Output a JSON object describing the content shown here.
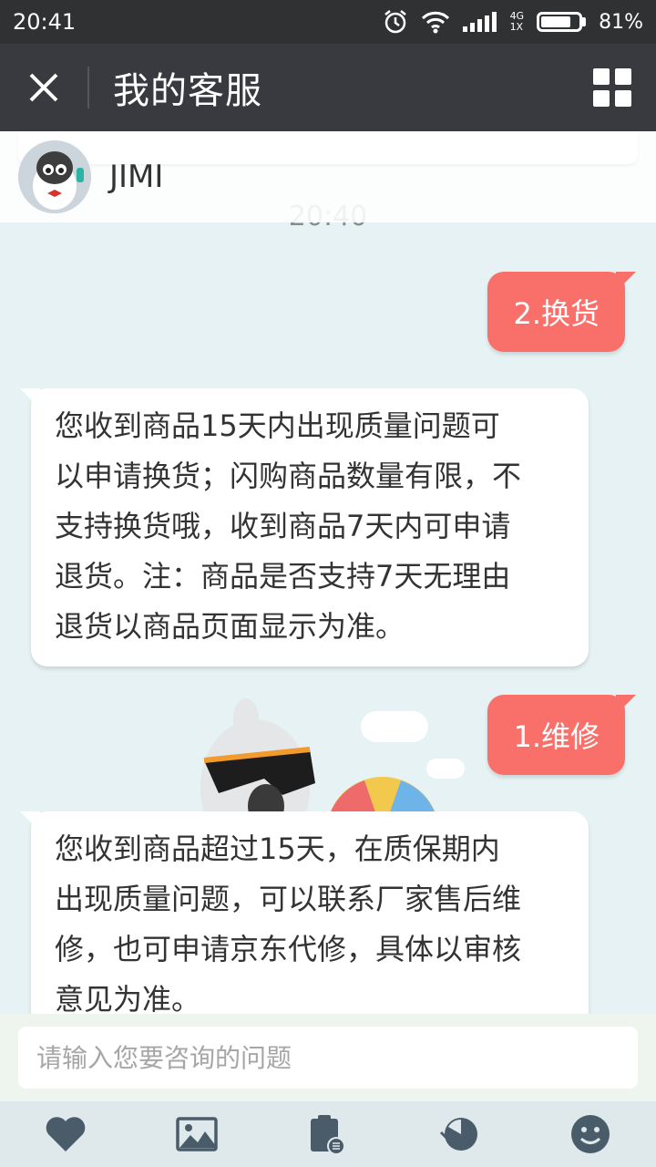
{
  "status_bar": {
    "time": "20:41",
    "network": "4G",
    "network_sub": "1X",
    "battery_percent": "81%",
    "battery_level": 0.81
  },
  "header": {
    "title": "我的客服"
  },
  "agent": {
    "name": "JIMI"
  },
  "chat": {
    "timestamp": "20:40",
    "messages": [
      {
        "from": "user",
        "text": "2.换货"
      },
      {
        "from": "agent",
        "lines": [
          "您收到商品15天内出现质量问题可",
          "以申请换货；闪购商品数量有限，不",
          "支持换货哦，收到商品7天内可申请",
          "退货。注：商品是否支持7天无理由",
          "退货以商品页面显示为准。"
        ]
      },
      {
        "from": "user",
        "text": "1.维修"
      },
      {
        "from": "agent",
        "lines": [
          "您收到商品超过15天，在质保期内",
          "出现质量问题，可以联系厂家售后维",
          "修，也可申请京东代修，具体以审核",
          "意见为准。"
        ]
      }
    ]
  },
  "input": {
    "placeholder": "请输入您要咨询的问题"
  },
  "toolbar": {
    "icons": [
      "heart-icon",
      "image-icon",
      "order-icon",
      "history-icon",
      "emoji-icon"
    ]
  },
  "colors": {
    "status_bar": "#2f3133",
    "title_bar": "#393a3f",
    "user_bubble": "#f9706b",
    "chat_bg": "#e6f2f3",
    "icon": "#4a5c6a"
  }
}
